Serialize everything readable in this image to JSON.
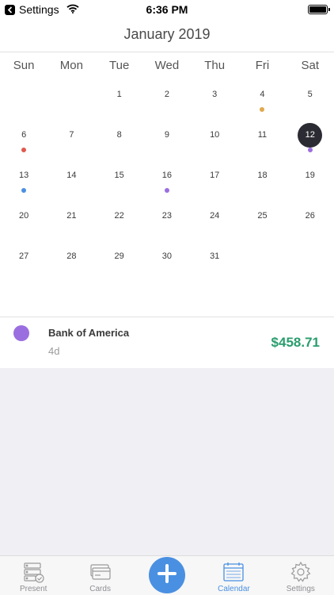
{
  "status_bar": {
    "back_label": "Settings",
    "time": "6:36 PM"
  },
  "title": "January 2019",
  "weekdays": [
    "Sun",
    "Mon",
    "Tue",
    "Wed",
    "Thu",
    "Fri",
    "Sat"
  ],
  "calendar": {
    "weeks": [
      [
        null,
        null,
        "1",
        "2",
        "3",
        "4",
        "5"
      ],
      [
        "6",
        "7",
        "8",
        "9",
        "10",
        "11",
        "12"
      ],
      [
        "13",
        "14",
        "15",
        "16",
        "17",
        "18",
        "19"
      ],
      [
        "20",
        "21",
        "22",
        "23",
        "24",
        "25",
        "26"
      ],
      [
        "27",
        "28",
        "29",
        "30",
        "31",
        null,
        null
      ]
    ],
    "selected_day": "12",
    "event_dots": {
      "4": "#e0a94e",
      "6": "#e05a4e",
      "12": "#9b6ee0",
      "13": "#4a90e2",
      "16": "#9b6ee0"
    }
  },
  "event": {
    "name": "Bank of America",
    "days": "4d",
    "amount": "$458.71",
    "dot_color": "#9b6ee0",
    "amount_color": "#2a9d6e"
  },
  "tabs": [
    {
      "label": "Present",
      "icon": "present-icon",
      "active": false
    },
    {
      "label": "Cards",
      "icon": "cards-icon",
      "active": false
    },
    {
      "label": "Calendar",
      "icon": "calendar-icon",
      "active": true
    },
    {
      "label": "Settings",
      "icon": "gear-icon",
      "active": false
    }
  ],
  "colors": {
    "accent": "#4a90e2",
    "selected_day": "#2b2b33",
    "add_button": "#4a90e2"
  }
}
